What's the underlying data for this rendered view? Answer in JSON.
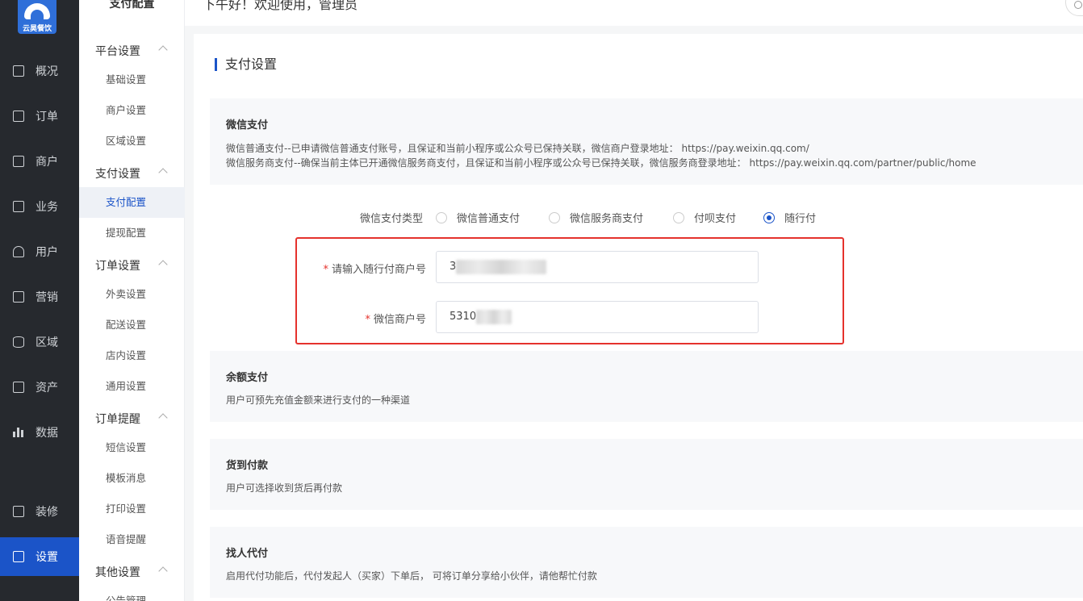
{
  "logo": {
    "text": "云昊餐饮"
  },
  "sidebar": {
    "items": [
      {
        "label": "概况",
        "icon": "monitor-icon"
      },
      {
        "label": "订单",
        "icon": "document-icon"
      },
      {
        "label": "商户",
        "icon": "store-icon"
      },
      {
        "label": "业务",
        "icon": "briefcase-icon"
      },
      {
        "label": "用户",
        "icon": "user-icon"
      },
      {
        "label": "营销",
        "icon": "marketing-icon"
      },
      {
        "label": "区域",
        "icon": "database-icon"
      },
      {
        "label": "资产",
        "icon": "wallet-icon"
      },
      {
        "label": "数据",
        "icon": "bar-chart-icon"
      },
      {
        "label": "装修",
        "icon": "decoration-icon"
      },
      {
        "label": "设置",
        "icon": "settings-icon"
      }
    ]
  },
  "subnav": {
    "title": "支付配置",
    "groups": [
      {
        "label": "平台设置",
        "items": [
          "基础设置",
          "商户设置",
          "区域设置"
        ]
      },
      {
        "label": "支付设置",
        "items": [
          "支付配置",
          "提现配置"
        ]
      },
      {
        "label": "订单设置",
        "items": [
          "外卖设置",
          "配送设置",
          "店内设置",
          "通用设置"
        ]
      },
      {
        "label": "订单提醒",
        "items": [
          "短信设置",
          "模板消息",
          "打印设置",
          "语音提醒"
        ]
      },
      {
        "label": "其他设置",
        "items": [
          "公告管理"
        ]
      }
    ]
  },
  "header": {
    "greeting": "下午好！欢迎使用，管理员"
  },
  "main": {
    "section_title": "支付设置",
    "wechat": {
      "title": "微信支付",
      "line1": "微信普通支付--已申请微信普通支付账号，且保证和当前小程序或公众号已保持关联，微信商户登录地址： https://pay.weixin.qq.com/",
      "line2": "微信服务商支付--确保当前主体已开通微信服务商支付，且保证和当前小程序或公众号已保持关联，微信服务商登录地址： https://pay.weixin.qq.com/partner/public/home"
    },
    "pay_type": {
      "label": "微信支付类型",
      "options": [
        "微信普通支付",
        "微信服务商支付",
        "付呗支付",
        "随行付"
      ],
      "selected": "随行付"
    },
    "fields": {
      "merchant_no_label": "请输入随行付商户号",
      "merchant_no_value": "3",
      "wechat_merchant_label": "微信商户号",
      "wechat_merchant_value": "5310"
    },
    "balance": {
      "title": "余额支付",
      "desc": "用户可预先充值金额来进行支付的一种渠道"
    },
    "cod": {
      "title": "货到付款",
      "desc": "用户可选择收到货后再付款"
    },
    "proxy": {
      "title": "找人代付",
      "desc": "启用代付功能后，代付发起人（买家）下单后， 可将订单分享给小伙伴，请他帮忙付款"
    }
  },
  "colors": {
    "primary": "#1b54c8",
    "sidebar_bg": "#26292e",
    "highlight_frame": "#e5322d"
  }
}
